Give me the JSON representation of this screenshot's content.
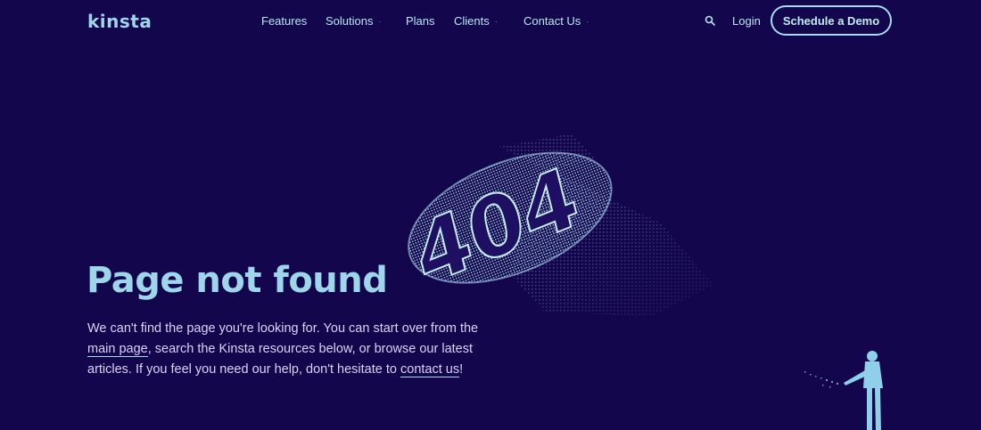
{
  "brand": {
    "logo_text": "kinsta"
  },
  "nav": {
    "items": [
      {
        "label": "Features",
        "has_dropdown": false
      },
      {
        "label": "Solutions",
        "has_dropdown": true
      },
      {
        "label": "Plans",
        "has_dropdown": false
      },
      {
        "label": "Clients",
        "has_dropdown": true
      },
      {
        "label": "Contact Us",
        "has_dropdown": true
      }
    ],
    "search_icon": "search-icon",
    "login_label": "Login",
    "cta_label": "Schedule a Demo"
  },
  "hero": {
    "illustration_text": "404",
    "title": "Page not found",
    "desc_part1": "We can't find the page you're looking for. You can start over from the ",
    "main_page_link": "main page",
    "desc_part2": ", search the Kinsta resources below, or browse our latest articles. If you feel you need our help, don't hesitate to ",
    "contact_link": "contact us",
    "desc_part3": "!"
  },
  "colors": {
    "background": "#13064c",
    "accent": "#9fd5ea",
    "text": "#d9d3f7"
  }
}
